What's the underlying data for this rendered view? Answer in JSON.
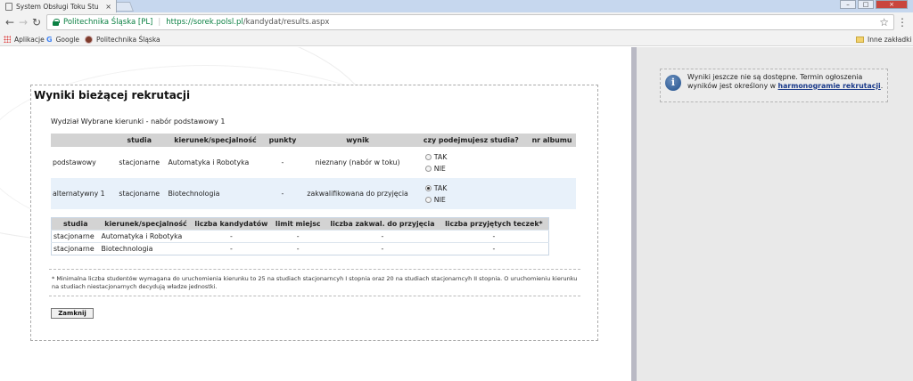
{
  "browser": {
    "tab_title": "System Obsługi Toku Stu",
    "tab_close": "×",
    "site_name": "Politechnika Śląska [PL]",
    "url_host": "https://sorek.polsl.pl",
    "url_path": "/kandydat/results.aspx",
    "bookmarks": [
      "Aplikacje",
      "Google",
      "Politechnika Śląska"
    ],
    "other_bookmarks": "Inne zakładki"
  },
  "info": {
    "text": "Wyniki jeszcze nie są dostępne. Termin ogłoszenia wyników jest określony w ",
    "link": "harmonogramie rekrutacji",
    "end": "."
  },
  "main": {
    "title": "Wyniki bieżącej rekrutacji",
    "subtitle": "Wydział Wybrane kierunki - nabór podstawowy 1",
    "results_headers": [
      "",
      "studia",
      "kierunek/specjalność",
      "punkty",
      "wynik",
      "czy podejmujesz studia?",
      "nr albumu"
    ],
    "results_rows": [
      {
        "type": "podstawowy",
        "studia": "stacjonarne",
        "kierunek": "Automatyka i Robotyka",
        "punkty": "-",
        "wynik": "nieznany (nabór w toku)",
        "tak": "TAK",
        "nie": "NIE",
        "album": ""
      },
      {
        "type": "alternatywny 1",
        "studia": "stacjonarne",
        "kierunek": "Biotechnologia",
        "punkty": "-",
        "wynik": "zakwalifikowana do przyjęcia",
        "tak": "TAK",
        "nie": "NIE",
        "album": ""
      }
    ],
    "stats_headers": [
      "studia",
      "kierunek/specjalność",
      "liczba kandydatów",
      "limit miejsc",
      "liczba zakwal. do przyjęcia",
      "liczba przyjętych teczek*"
    ],
    "stats_rows": [
      {
        "studia": "stacjonarne",
        "kierunek": "Automatyka i Robotyka",
        "kandydatow": "-",
        "limit": "-",
        "zakwal": "-",
        "teczek": "-"
      },
      {
        "studia": "stacjonarne",
        "kierunek": "Biotechnologia",
        "kandydatow": "-",
        "limit": "-",
        "zakwal": "-",
        "teczek": "-"
      }
    ],
    "note": "* Minimalna liczba studentów wymagana do uruchomienia kierunku to 25 na studiach stacjonarncyh I stopnia oraz 20 na studiach stacjonarncyh II stopnia. O uruchomieniu kierunku na studiach niestacjonarnych decydują władze jednostki.",
    "close_button": "Zamknij"
  }
}
